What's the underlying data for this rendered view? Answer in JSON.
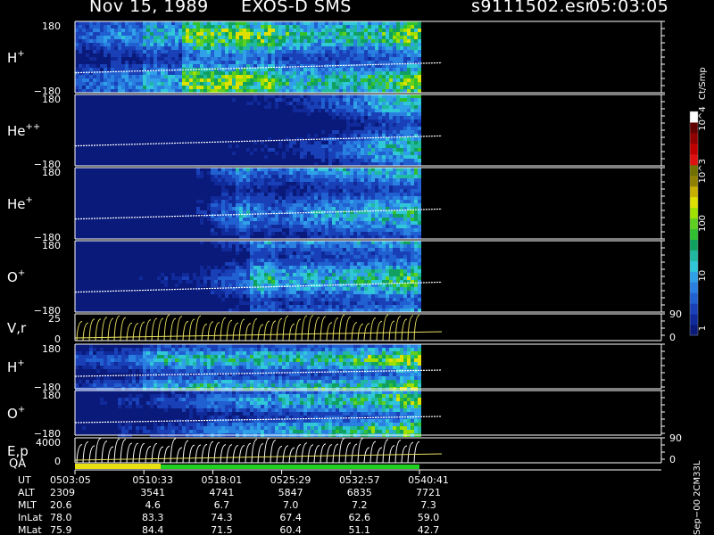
{
  "header": {
    "date": "Nov 15, 1989",
    "instrument": "EXOS-D SMS",
    "file": "s9111502.esr",
    "time": "05:03:05"
  },
  "colorbar": {
    "unit_label": "Ct/Smp",
    "ticks": [
      "1",
      "10",
      "100",
      "10^3",
      "10^4"
    ],
    "colors": [
      "#0a1a7a",
      "#102a9a",
      "#1a40b8",
      "#2060d0",
      "#2a80e0",
      "#30a0e8",
      "#30c8d8",
      "#20b8a0",
      "#10a060",
      "#30c030",
      "#60d020",
      "#a0e000",
      "#e0e000",
      "#c8b000",
      "#908000",
      "#707000",
      "#e01010",
      "#c00000",
      "#900000",
      "#600000",
      "#ffffff"
    ]
  },
  "panels": [
    {
      "label": "H",
      "sup": "+",
      "top": "180",
      "bottom": "−180"
    },
    {
      "label": "He",
      "sup": "++",
      "top": "180",
      "bottom": "−180"
    },
    {
      "label": "He",
      "sup": "+",
      "top": "180",
      "bottom": "−180"
    },
    {
      "label": "O",
      "sup": "+",
      "top": "180",
      "bottom": "−180"
    },
    {
      "label": "V,r",
      "sup": "",
      "top": "25",
      "bottom": "0",
      "right_top": "90",
      "right_bottom": "0"
    },
    {
      "label": "H",
      "sup": "+",
      "top": "180",
      "bottom": "−180"
    },
    {
      "label": "O",
      "sup": "+",
      "top": "180",
      "bottom": "−180"
    },
    {
      "label": "E,p",
      "sup": "",
      "top": "4000",
      "bottom": "0",
      "right_top": "90",
      "right_bottom": "0"
    }
  ],
  "qa_label": "QA",
  "side_label": "Sep−00 2CM33L",
  "ephemeris": {
    "row_labels": [
      "UT",
      "ALT",
      "MLT",
      "InLat",
      "MLat"
    ],
    "columns": [
      [
        "0503:05",
        "2309",
        "20.6",
        "78.0",
        "75.9"
      ],
      [
        "0510:33",
        "3541",
        "4.6",
        "83.3",
        "84.4"
      ],
      [
        "0518:01",
        "4741",
        "6.7",
        "74.3",
        "71.5"
      ],
      [
        "0525:29",
        "5847",
        "7.0",
        "67.4",
        "60.4"
      ],
      [
        "0532:57",
        "6835",
        "7.2",
        "62.6",
        "51.1"
      ],
      [
        "0540:41",
        "7721",
        "7.3",
        "59.0",
        "42.7"
      ]
    ]
  },
  "chart_data": {
    "type": "heatmap",
    "x": [
      "0503:05",
      "0510:33",
      "0518:01",
      "0525:29",
      "0532:57",
      "0540:41"
    ],
    "data_end": "0540:41",
    "series": [
      {
        "name": "H+",
        "ylim": [
          -180,
          180
        ],
        "activity": [
          0.25,
          0.3,
          0.35,
          0.4,
          0.35,
          0.55,
          0.5,
          0.45,
          0.85,
          0.8,
          0.85,
          0.8,
          0.9,
          0.75,
          0.85,
          0.65,
          0.6,
          0.6,
          0.55,
          0.55,
          0.6,
          0.6,
          0.65,
          0.7,
          0.75,
          0.85
        ]
      },
      {
        "name": "He++",
        "ylim": [
          -180,
          180
        ],
        "activity": [
          0.05,
          0.05,
          0.05,
          0.05,
          0.05,
          0.05,
          0.05,
          0.05,
          0.05,
          0.08,
          0.08,
          0.1,
          0.1,
          0.12,
          0.12,
          0.12,
          0.15,
          0.18,
          0.2,
          0.25,
          0.3,
          0.35,
          0.45,
          0.5,
          0.55,
          0.6
        ]
      },
      {
        "name": "He+",
        "ylim": [
          -180,
          180
        ],
        "activity": [
          0.05,
          0.05,
          0.05,
          0.05,
          0.05,
          0.05,
          0.05,
          0.08,
          0.1,
          0.15,
          0.25,
          0.3,
          0.45,
          0.35,
          0.3,
          0.3,
          0.35,
          0.4,
          0.45,
          0.45,
          0.5,
          0.5,
          0.55,
          0.55,
          0.6,
          0.65
        ]
      },
      {
        "name": "O+",
        "ylim": [
          -180,
          180
        ],
        "activity": [
          0.05,
          0.05,
          0.05,
          0.08,
          0.1,
          0.1,
          0.12,
          0.12,
          0.12,
          0.15,
          0.2,
          0.25,
          0.3,
          0.55,
          0.6,
          0.45,
          0.5,
          0.55,
          0.5,
          0.5,
          0.55,
          0.6,
          0.6,
          0.65,
          0.7,
          0.75
        ]
      },
      {
        "name": "H+ (2)",
        "ylim": [
          -180,
          180
        ],
        "activity": [
          0.2,
          0.25,
          0.25,
          0.25,
          0.3,
          0.5,
          0.55,
          0.55,
          0.55,
          0.6,
          0.6,
          0.55,
          0.55,
          0.6,
          0.6,
          0.55,
          0.6,
          0.6,
          0.6,
          0.65,
          0.65,
          0.7,
          0.75,
          0.8,
          0.85,
          0.9
        ]
      },
      {
        "name": "O+ (2)",
        "ylim": [
          -180,
          180
        ],
        "activity": [
          0.1,
          0.1,
          0.1,
          0.15,
          0.15,
          0.15,
          0.2,
          0.2,
          0.25,
          0.3,
          0.35,
          0.35,
          0.4,
          0.45,
          0.45,
          0.5,
          0.5,
          0.55,
          0.55,
          0.6,
          0.6,
          0.65,
          0.7,
          0.75,
          0.8,
          0.85
        ]
      }
    ]
  }
}
